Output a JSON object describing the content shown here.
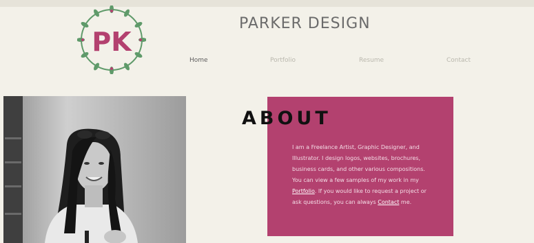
{
  "header": {
    "logo_text": "PK",
    "site_title": "PARKER DESIGN"
  },
  "nav": {
    "items": [
      {
        "label": "Home",
        "active": true
      },
      {
        "label": "Portfolio",
        "active": false
      },
      {
        "label": "Resume",
        "active": false
      },
      {
        "label": "Contact",
        "active": false
      }
    ]
  },
  "about": {
    "heading": "ABOUT",
    "text_part1": "I am a Freelance Artist, Graphic Designer, and Illustrator. I design logos, websites, brochures, business cards, and other various compositions. You can view a few samples of my work in my ",
    "portfolio_link": "Portfolio",
    "text_part2": ". If you would like to request a project or ask questions, you can always ",
    "contact_link": "Contact",
    "text_part3": " me."
  },
  "colors": {
    "background": "#f3f1e9",
    "accent": "#b3416f",
    "wreath": "#5f9a6a"
  }
}
